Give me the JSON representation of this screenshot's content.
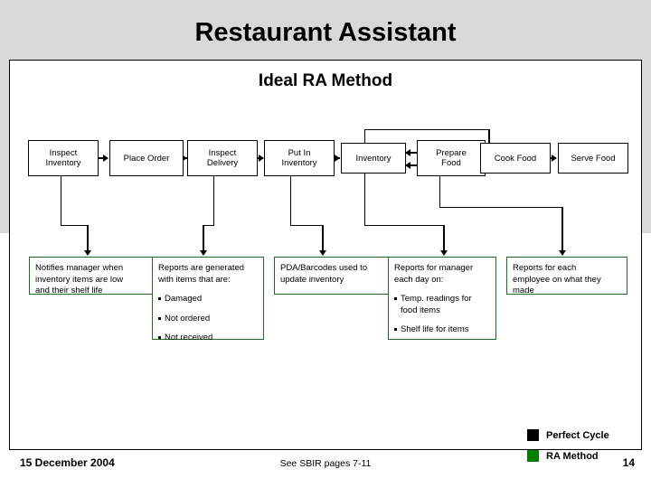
{
  "slide": {
    "title": "Restaurant Assistant",
    "diagram_title": "Ideal RA Method"
  },
  "colors": {
    "perfect_cycle": "#000000",
    "ra_method": "#1f6b23",
    "ra_method_swatch": "#018000",
    "background_band": "#d8d8d8",
    "panel": "#ffffff"
  },
  "process_boxes": [
    {
      "label_line1": "Inspect",
      "label_line2": "Inventory"
    },
    {
      "label_line1": "Place Order",
      "label_line2": ""
    },
    {
      "label_line1": "Inspect",
      "label_line2": "Delivery"
    },
    {
      "label_line1": "Put In",
      "label_line2": "Inventory"
    },
    {
      "label_line1": "Inventory",
      "label_line2": ""
    },
    {
      "label_line1": "Prepare",
      "label_line2": "Food"
    },
    {
      "label_line1": "Cook Food",
      "label_line2": ""
    },
    {
      "label_line1": "Serve Food",
      "label_line2": ""
    }
  ],
  "note_boxes": [
    {
      "lines": [
        "Notifies manager when",
        "inventory items are low",
        "and their shelf life"
      ],
      "bullets": []
    },
    {
      "lines": [
        "Reports are generated",
        "with items that are:"
      ],
      "bullets": [
        "Damaged",
        "Not ordered",
        "Not received"
      ]
    },
    {
      "lines": [
        "PDA/Barcodes used to",
        "update inventory"
      ],
      "bullets": []
    },
    {
      "lines": [
        "Reports for manager",
        "each day on:"
      ],
      "bullets": [
        "Temp. readings for food items",
        "Shelf life for items"
      ]
    },
    {
      "lines": [
        "Reports for each",
        "employee on what they",
        "made"
      ],
      "bullets": []
    }
  ],
  "legend": {
    "items": [
      {
        "label": "Perfect Cycle",
        "color": "#000000"
      },
      {
        "label": "RA Method",
        "color": "#018000"
      }
    ]
  },
  "footer": {
    "date": "15 December 2004",
    "note": "See SBIR pages 7-11",
    "page": "14"
  }
}
